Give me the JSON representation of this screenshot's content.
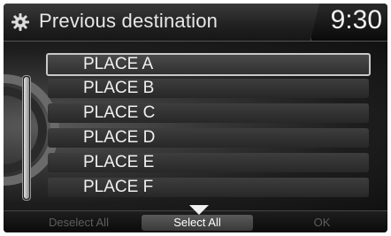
{
  "header": {
    "title": "Previous destination",
    "time": "9:30",
    "icon": "gear-icon"
  },
  "list": {
    "items": [
      {
        "label": "PLACE A",
        "selected": true
      },
      {
        "label": "PLACE B",
        "selected": false
      },
      {
        "label": "PLACE C",
        "selected": false
      },
      {
        "label": "PLACE D",
        "selected": false
      },
      {
        "label": "PLACE E",
        "selected": false
      },
      {
        "label": "PLACE F",
        "selected": false
      }
    ]
  },
  "footer": {
    "deselect_all": "Deselect All",
    "select_all": "Select All",
    "ok": "OK"
  }
}
